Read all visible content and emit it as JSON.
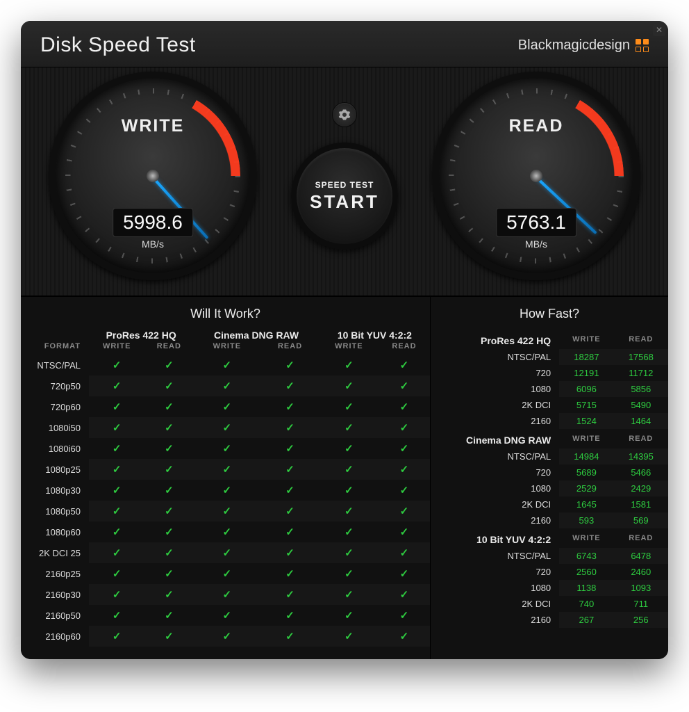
{
  "app": {
    "title": "Disk Speed Test",
    "brand": "Blackmagicdesign"
  },
  "gauges": {
    "write": {
      "label": "WRITE",
      "value": "5998.6",
      "unit": "MB/s",
      "needle_deg": 48
    },
    "read": {
      "label": "READ",
      "value": "5763.1",
      "unit": "MB/s",
      "needle_deg": 43
    }
  },
  "start_btn": {
    "top": "SPEED TEST",
    "main": "START"
  },
  "wiw": {
    "title": "Will It Work?",
    "format_header": "FORMAT",
    "sub_write": "WRITE",
    "sub_read": "READ",
    "codecs": [
      "ProRes 422 HQ",
      "Cinema DNG RAW",
      "10 Bit YUV 4:2:2"
    ],
    "rows": [
      {
        "fmt": "NTSC/PAL",
        "cells": [
          true,
          true,
          true,
          true,
          true,
          true
        ]
      },
      {
        "fmt": "720p50",
        "cells": [
          true,
          true,
          true,
          true,
          true,
          true
        ]
      },
      {
        "fmt": "720p60",
        "cells": [
          true,
          true,
          true,
          true,
          true,
          true
        ]
      },
      {
        "fmt": "1080i50",
        "cells": [
          true,
          true,
          true,
          true,
          true,
          true
        ]
      },
      {
        "fmt": "1080i60",
        "cells": [
          true,
          true,
          true,
          true,
          true,
          true
        ]
      },
      {
        "fmt": "1080p25",
        "cells": [
          true,
          true,
          true,
          true,
          true,
          true
        ]
      },
      {
        "fmt": "1080p30",
        "cells": [
          true,
          true,
          true,
          true,
          true,
          true
        ]
      },
      {
        "fmt": "1080p50",
        "cells": [
          true,
          true,
          true,
          true,
          true,
          true
        ]
      },
      {
        "fmt": "1080p60",
        "cells": [
          true,
          true,
          true,
          true,
          true,
          true
        ]
      },
      {
        "fmt": "2K DCI 25",
        "cells": [
          true,
          true,
          true,
          true,
          true,
          true
        ]
      },
      {
        "fmt": "2160p25",
        "cells": [
          true,
          true,
          true,
          true,
          true,
          true
        ]
      },
      {
        "fmt": "2160p30",
        "cells": [
          true,
          true,
          true,
          true,
          true,
          true
        ]
      },
      {
        "fmt": "2160p50",
        "cells": [
          true,
          true,
          true,
          true,
          true,
          true
        ]
      },
      {
        "fmt": "2160p60",
        "cells": [
          true,
          true,
          true,
          true,
          true,
          true
        ]
      }
    ]
  },
  "hf": {
    "title": "How Fast?",
    "hdr_write": "WRITE",
    "hdr_read": "READ",
    "sections": [
      {
        "codec": "ProRes 422 HQ",
        "rows": [
          {
            "fmt": "NTSC/PAL",
            "w": "18287",
            "r": "17568"
          },
          {
            "fmt": "720",
            "w": "12191",
            "r": "11712"
          },
          {
            "fmt": "1080",
            "w": "6096",
            "r": "5856"
          },
          {
            "fmt": "2K DCI",
            "w": "5715",
            "r": "5490"
          },
          {
            "fmt": "2160",
            "w": "1524",
            "r": "1464"
          }
        ]
      },
      {
        "codec": "Cinema DNG RAW",
        "rows": [
          {
            "fmt": "NTSC/PAL",
            "w": "14984",
            "r": "14395"
          },
          {
            "fmt": "720",
            "w": "5689",
            "r": "5466"
          },
          {
            "fmt": "1080",
            "w": "2529",
            "r": "2429"
          },
          {
            "fmt": "2K DCI",
            "w": "1645",
            "r": "1581"
          },
          {
            "fmt": "2160",
            "w": "593",
            "r": "569"
          }
        ]
      },
      {
        "codec": "10 Bit YUV 4:2:2",
        "rows": [
          {
            "fmt": "NTSC/PAL",
            "w": "6743",
            "r": "6478"
          },
          {
            "fmt": "720",
            "w": "2560",
            "r": "2460"
          },
          {
            "fmt": "1080",
            "w": "1138",
            "r": "1093"
          },
          {
            "fmt": "2K DCI",
            "w": "740",
            "r": "711"
          },
          {
            "fmt": "2160",
            "w": "267",
            "r": "256"
          }
        ]
      }
    ]
  }
}
